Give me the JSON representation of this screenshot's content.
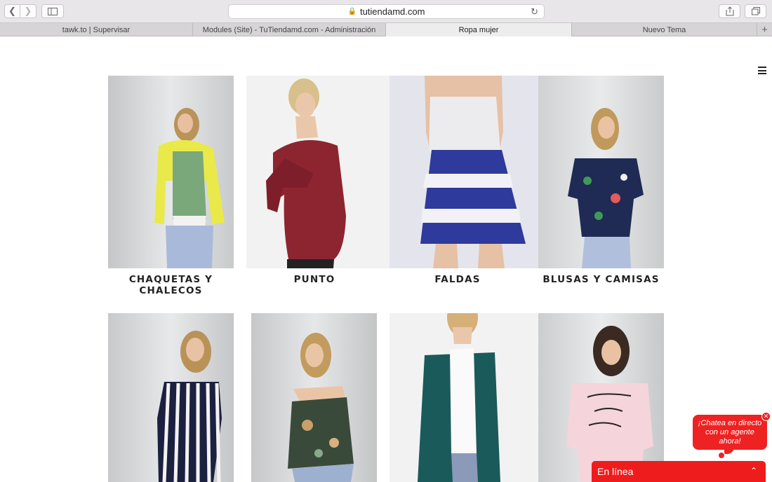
{
  "browser": {
    "url": "tutiendamd.com",
    "tabs": [
      {
        "label": "tawk.to | Supervisar"
      },
      {
        "label": "Modules (Site) - TuTiendamd.com - Administración"
      },
      {
        "label": "Ropa mujer"
      },
      {
        "label": "Nuevo Tema"
      }
    ],
    "active_tab": 2
  },
  "categories": [
    {
      "label": "CHAQUETAS Y\nCHALECOS"
    },
    {
      "label": "PUNTO"
    },
    {
      "label": "FALDAS"
    },
    {
      "label": "BLUSAS Y CAMISAS"
    }
  ],
  "chat": {
    "bubble_text": "¡Chatea en directo con un agente ahora!",
    "bar_label": "En línea"
  },
  "colors": {
    "chat_red": "#ee1c1c"
  }
}
